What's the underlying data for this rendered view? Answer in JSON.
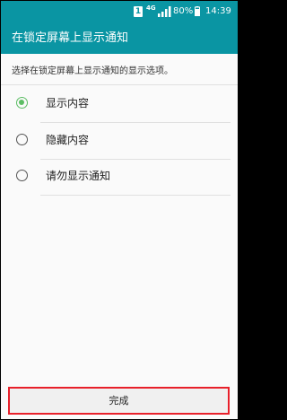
{
  "status_bar": {
    "sim_label": "1",
    "network_type": "4G",
    "battery_percent": "80%",
    "time": "14:39"
  },
  "app_bar": {
    "title": "在锁定屏幕上显示通知"
  },
  "description": "选择在锁定屏幕上显示通知的显示选项。",
  "options": [
    {
      "label": "显示内容",
      "selected": true
    },
    {
      "label": "隐藏内容",
      "selected": false
    },
    {
      "label": "请勿显示通知",
      "selected": false
    }
  ],
  "done_button": {
    "label": "完成"
  },
  "colors": {
    "primary": "#0a95a3",
    "radio_selected": "#5cbd64",
    "highlight_border": "#e8202a"
  }
}
